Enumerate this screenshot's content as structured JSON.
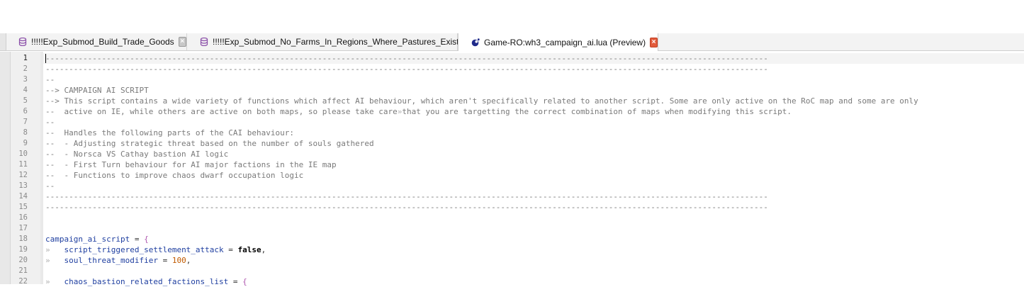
{
  "tabs": [
    {
      "label": "!!!!!Exp_Submod_Build_Trade_Goods",
      "icon": "database-icon",
      "active": false
    },
    {
      "label": "!!!!!Exp_Submod_No_Farms_In_Regions_Where_Pastures_Exist",
      "icon": "database-icon",
      "active": false
    },
    {
      "label": "Game-RO:wh3_campaign_ai.lua (Preview)",
      "icon": "lua-file-icon",
      "active": true
    }
  ],
  "close_glyph": "×",
  "editor": {
    "current_line": 1,
    "line_numbers": [
      "1",
      "2",
      "3",
      "4",
      "5",
      "6",
      "7",
      "8",
      "9",
      "10",
      "11",
      "12",
      "13",
      "14",
      "15",
      "16",
      "17",
      "18",
      "19",
      "20",
      "21",
      "22"
    ],
    "comments": {
      "dash_rule": "----------------------------------------------------------------------------------------------------------------------------------------------------------",
      "l3": "--",
      "l4": "--> CAMPAIGN AI SCRIPT",
      "l5": "--> This script contains a wide variety of functions which affect AI behaviour, which aren't specifically related to another script. Some are only active on the RoC map and some are only",
      "l6a": "--  active on IE, while others are active on both maps, so please take care",
      "l6b": "that you are targetting the correct combination of maps when modifying this script.",
      "l7": "--",
      "l8": "--  Handles the following parts of the CAI behaviour:",
      "l9": "--  - Adjusting strategic threat based on the number of souls gathered",
      "l10": "--  - Norsca VS Cathay bastion AI logic",
      "l11": "--  - First Turn behaviour for AI major factions in the IE map",
      "l12": "--  - Functions to improve chaos dwarf occupation logic",
      "l13": "--"
    },
    "code": {
      "l18_ident": "campaign_ai_script",
      "l18_op": " = ",
      "l18_brace": "{",
      "tab_glyph": "»",
      "l19_ident": "script_triggered_settlement_attack",
      "l19_op": " = ",
      "l19_kw": "false",
      "l19_end": ",",
      "l20_ident": "soul_threat_modifier",
      "l20_op": " = ",
      "l20_num": "100",
      "l20_end": ",",
      "l22_ident": "chaos_bastion_related_factions_list",
      "l22_op": " = ",
      "l22_brace": "{"
    }
  }
}
